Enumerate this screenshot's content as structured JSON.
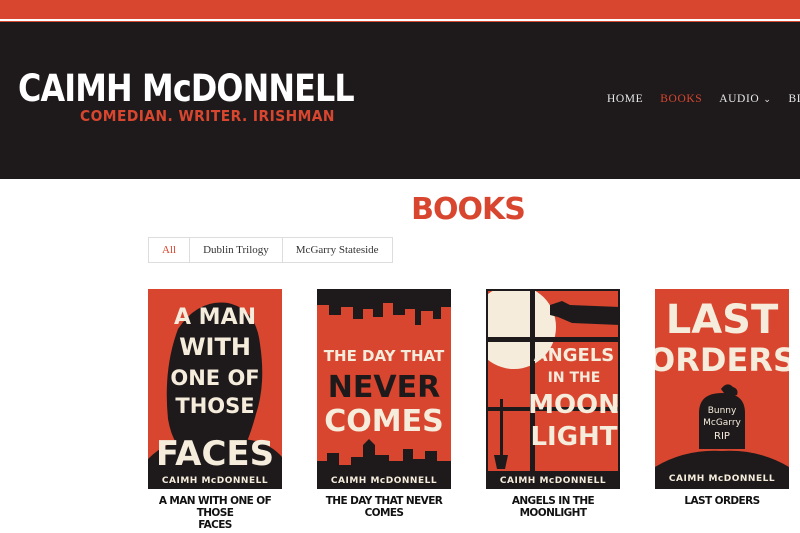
{
  "site": {
    "logo_name": "CAIMH McDONNELL",
    "logo_tagline": "COMEDIAN. WRITER. IRISHMAN"
  },
  "nav": {
    "items": [
      {
        "label": "HOME"
      },
      {
        "label": "BOOKS",
        "active": true
      },
      {
        "label": "AUDIO",
        "has_dropdown": true
      },
      {
        "label": "BLO"
      }
    ]
  },
  "page": {
    "title": "BOOKS"
  },
  "filters": {
    "items": [
      {
        "label": "All",
        "active": true
      },
      {
        "label": "Dublin Trilogy"
      },
      {
        "label": "McGarry Stateside"
      }
    ]
  },
  "books": [
    {
      "cover_lines": [
        "A MAN",
        "WITH",
        "ONE OF",
        "THOSE",
        "FACES"
      ],
      "cover_author": "CAIMH McDONNELL",
      "caption_line1": "A MAN WITH ONE OF THOSE",
      "caption_line2": "FACES"
    },
    {
      "cover_lines": [
        "THE DAY THAT",
        "NEVER",
        "COMES"
      ],
      "cover_author": "CAIMH McDONNELL",
      "caption_line1": "THE DAY THAT NEVER COMES",
      "caption_line2": ""
    },
    {
      "cover_lines": [
        "ANGELS",
        "IN THE",
        "MOON",
        "LIGHT"
      ],
      "cover_author": "CAIMH McDONNELL",
      "caption_line1": "ANGELS IN THE MOONLIGHT",
      "caption_line2": ""
    },
    {
      "cover_lines": [
        "LAST",
        "ORDERS"
      ],
      "tombstone_lines": [
        "Bunny",
        "McGarry",
        "RIP"
      ],
      "cover_author": "CAIMH McDONNELL",
      "caption_line1": "LAST ORDERS",
      "caption_line2": ""
    }
  ],
  "colors": {
    "accent": "#d8462f",
    "header_bg": "#1e1a1b",
    "cover_cream": "#f5ecdc"
  }
}
